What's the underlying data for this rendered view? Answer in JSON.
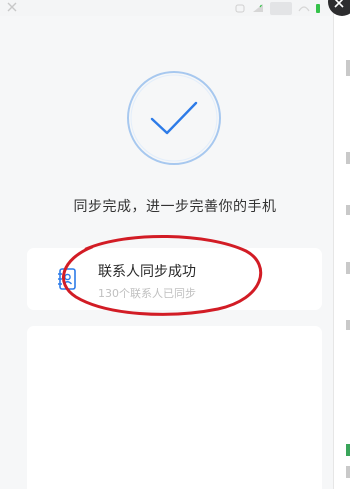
{
  "status_bar": {
    "left_icon": "close-icon",
    "right_icons": [
      "alarm-icon",
      "signal-icon",
      "wifi-icon",
      "battery-icon"
    ]
  },
  "result": {
    "icon": "checkmark-icon",
    "title": "同步完成，进一步完善你的手机"
  },
  "contacts_card": {
    "icon": "contacts-book-icon",
    "title": "联系人同步成功",
    "subtitle": "130个联系人已同步"
  },
  "annotation": {
    "shape": "hand-drawn-ellipse",
    "color": "#d21c25"
  },
  "colors": {
    "background": "#f6f7f8",
    "card": "#ffffff",
    "accent_blue": "#2d7be8",
    "circle_ring": "#a7c8ef",
    "annotation_red": "#d21c25",
    "battery_green": "#35c24a"
  }
}
